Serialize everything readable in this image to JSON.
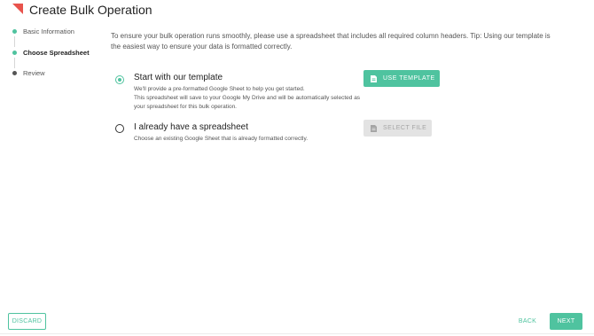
{
  "header": {
    "title": "Create Bulk Operation",
    "logo_icon": "red-triangle-logo-icon",
    "logo_color": "#e8534c"
  },
  "stepper": {
    "steps": [
      {
        "label": "Basic Information",
        "state": "completed"
      },
      {
        "label": "Choose Spreadsheet",
        "state": "active"
      },
      {
        "label": "Review",
        "state": "pending"
      }
    ]
  },
  "intro_text": "To ensure your bulk operation runs smoothly, please use a spreadsheet that includes all required column headers. Tip: Using our template is the easiest way to ensure your data is formatted correctly.",
  "options": [
    {
      "title": "Start with our template",
      "description_line1": "We'll provide a pre-formatted Google Sheet to help you get started.",
      "description_line2": "This spreadsheet will save to your Google My Drive and will be automatically selected as your spreadsheet for this bulk operation.",
      "selected": true,
      "button_label": "USE TEMPLATE",
      "button_icon": "document-icon"
    },
    {
      "title": "I already have a spreadsheet",
      "description_line1": "Choose an existing Google Sheet that is already formatted correctly.",
      "selected": false,
      "button_label": "SELECT FILE",
      "button_icon": "document-icon",
      "button_disabled": true
    }
  ],
  "footer": {
    "discard_label": "DISCARD",
    "back_label": "BACK",
    "next_label": "NEXT"
  },
  "colors": {
    "accent": "#4fc39f",
    "completed_step": "#4fc39f",
    "pending_step": "#555555",
    "disabled_button": "#e3e3e3"
  }
}
